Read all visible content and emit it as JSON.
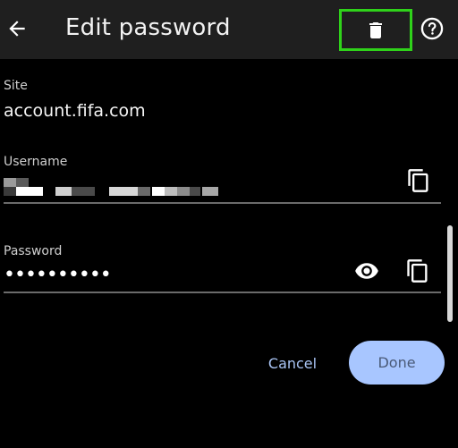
{
  "header": {
    "title": "Edit password",
    "back_icon": "arrow-left-icon",
    "delete_icon": "trash-icon",
    "help_icon": "help-circle-icon",
    "highlight_color": "#2fd21a"
  },
  "site": {
    "label": "Site",
    "value": "account.fifa.com"
  },
  "username": {
    "label": "Username",
    "value_redacted": true,
    "copy_icon": "copy-icon"
  },
  "password": {
    "label": "Password",
    "value": "••••••••••",
    "show_icon": "eye-icon",
    "copy_icon": "copy-icon"
  },
  "actions": {
    "cancel_label": "Cancel",
    "done_label": "Done"
  },
  "colors": {
    "background": "#000000",
    "appbar": "#1f1f1f",
    "accent": "#a8c6ff",
    "link": "#a9c4f4"
  }
}
